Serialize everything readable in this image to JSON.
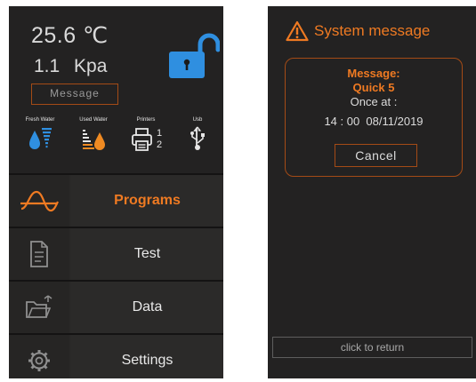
{
  "main_screen": {
    "temperature": "25.6 ℃",
    "pressure": "1.1   Kpa",
    "message_box": "Message",
    "lock_state": "unlocked",
    "indicators": [
      {
        "label": "Fresh Water",
        "icon": "fresh-water-icon"
      },
      {
        "label": "Used Water",
        "icon": "used-water-icon"
      },
      {
        "label": "Printers",
        "icon": "printer-icon",
        "values": [
          "1",
          "2"
        ]
      },
      {
        "label": "Usb",
        "icon": "usb-icon"
      }
    ],
    "menu": [
      {
        "label": "Programs",
        "icon": "wave-icon",
        "active": true
      },
      {
        "label": "Test",
        "icon": "document-icon",
        "active": false
      },
      {
        "label": "Data",
        "icon": "folder-icon",
        "active": false
      },
      {
        "label": "Settings",
        "icon": "gear-icon",
        "active": false
      }
    ]
  },
  "system_screen": {
    "title": "System message",
    "dialog": {
      "heading": "Message:",
      "name": "Quick 5",
      "frequency": "Once at :",
      "datetime": "14 : 00  08/11/2019",
      "cancel_label": "Cancel"
    },
    "return_label": "click to return"
  },
  "colors": {
    "accent": "#ef7a22",
    "border": "#a44b16",
    "screen_bg": "#232222",
    "lock": "#2f8fe0"
  }
}
